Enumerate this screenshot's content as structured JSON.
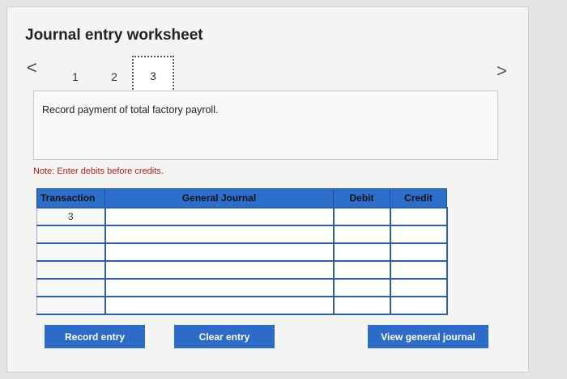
{
  "header": {
    "title": "Journal entry worksheet"
  },
  "pager": {
    "prev_icon": "chevron-left-icon",
    "next_icon": "chevron-right-icon",
    "prev_glyph": "<",
    "next_glyph": ">",
    "pages": [
      "1",
      "2",
      "3"
    ],
    "current": "3"
  },
  "instruction": {
    "text": "Record payment of total factory payroll."
  },
  "note": {
    "text": "Note: Enter debits before credits.",
    "color": "#b01e1e"
  },
  "table": {
    "columns": [
      "Transaction",
      "General Journal",
      "Debit",
      "Credit"
    ],
    "rows": [
      {
        "transaction": "3",
        "account": "",
        "debit": "",
        "credit": ""
      },
      {
        "transaction": "",
        "account": "",
        "debit": "",
        "credit": ""
      },
      {
        "transaction": "",
        "account": "",
        "debit": "",
        "credit": ""
      },
      {
        "transaction": "",
        "account": "",
        "debit": "",
        "credit": ""
      },
      {
        "transaction": "",
        "account": "",
        "debit": "",
        "credit": ""
      },
      {
        "transaction": "",
        "account": "",
        "debit": "",
        "credit": ""
      }
    ],
    "header_color": "#2c6fcb"
  },
  "buttons": {
    "record": "Record entry",
    "clear": "Clear entry",
    "view": "View general journal",
    "color": "#2c6cc8"
  }
}
